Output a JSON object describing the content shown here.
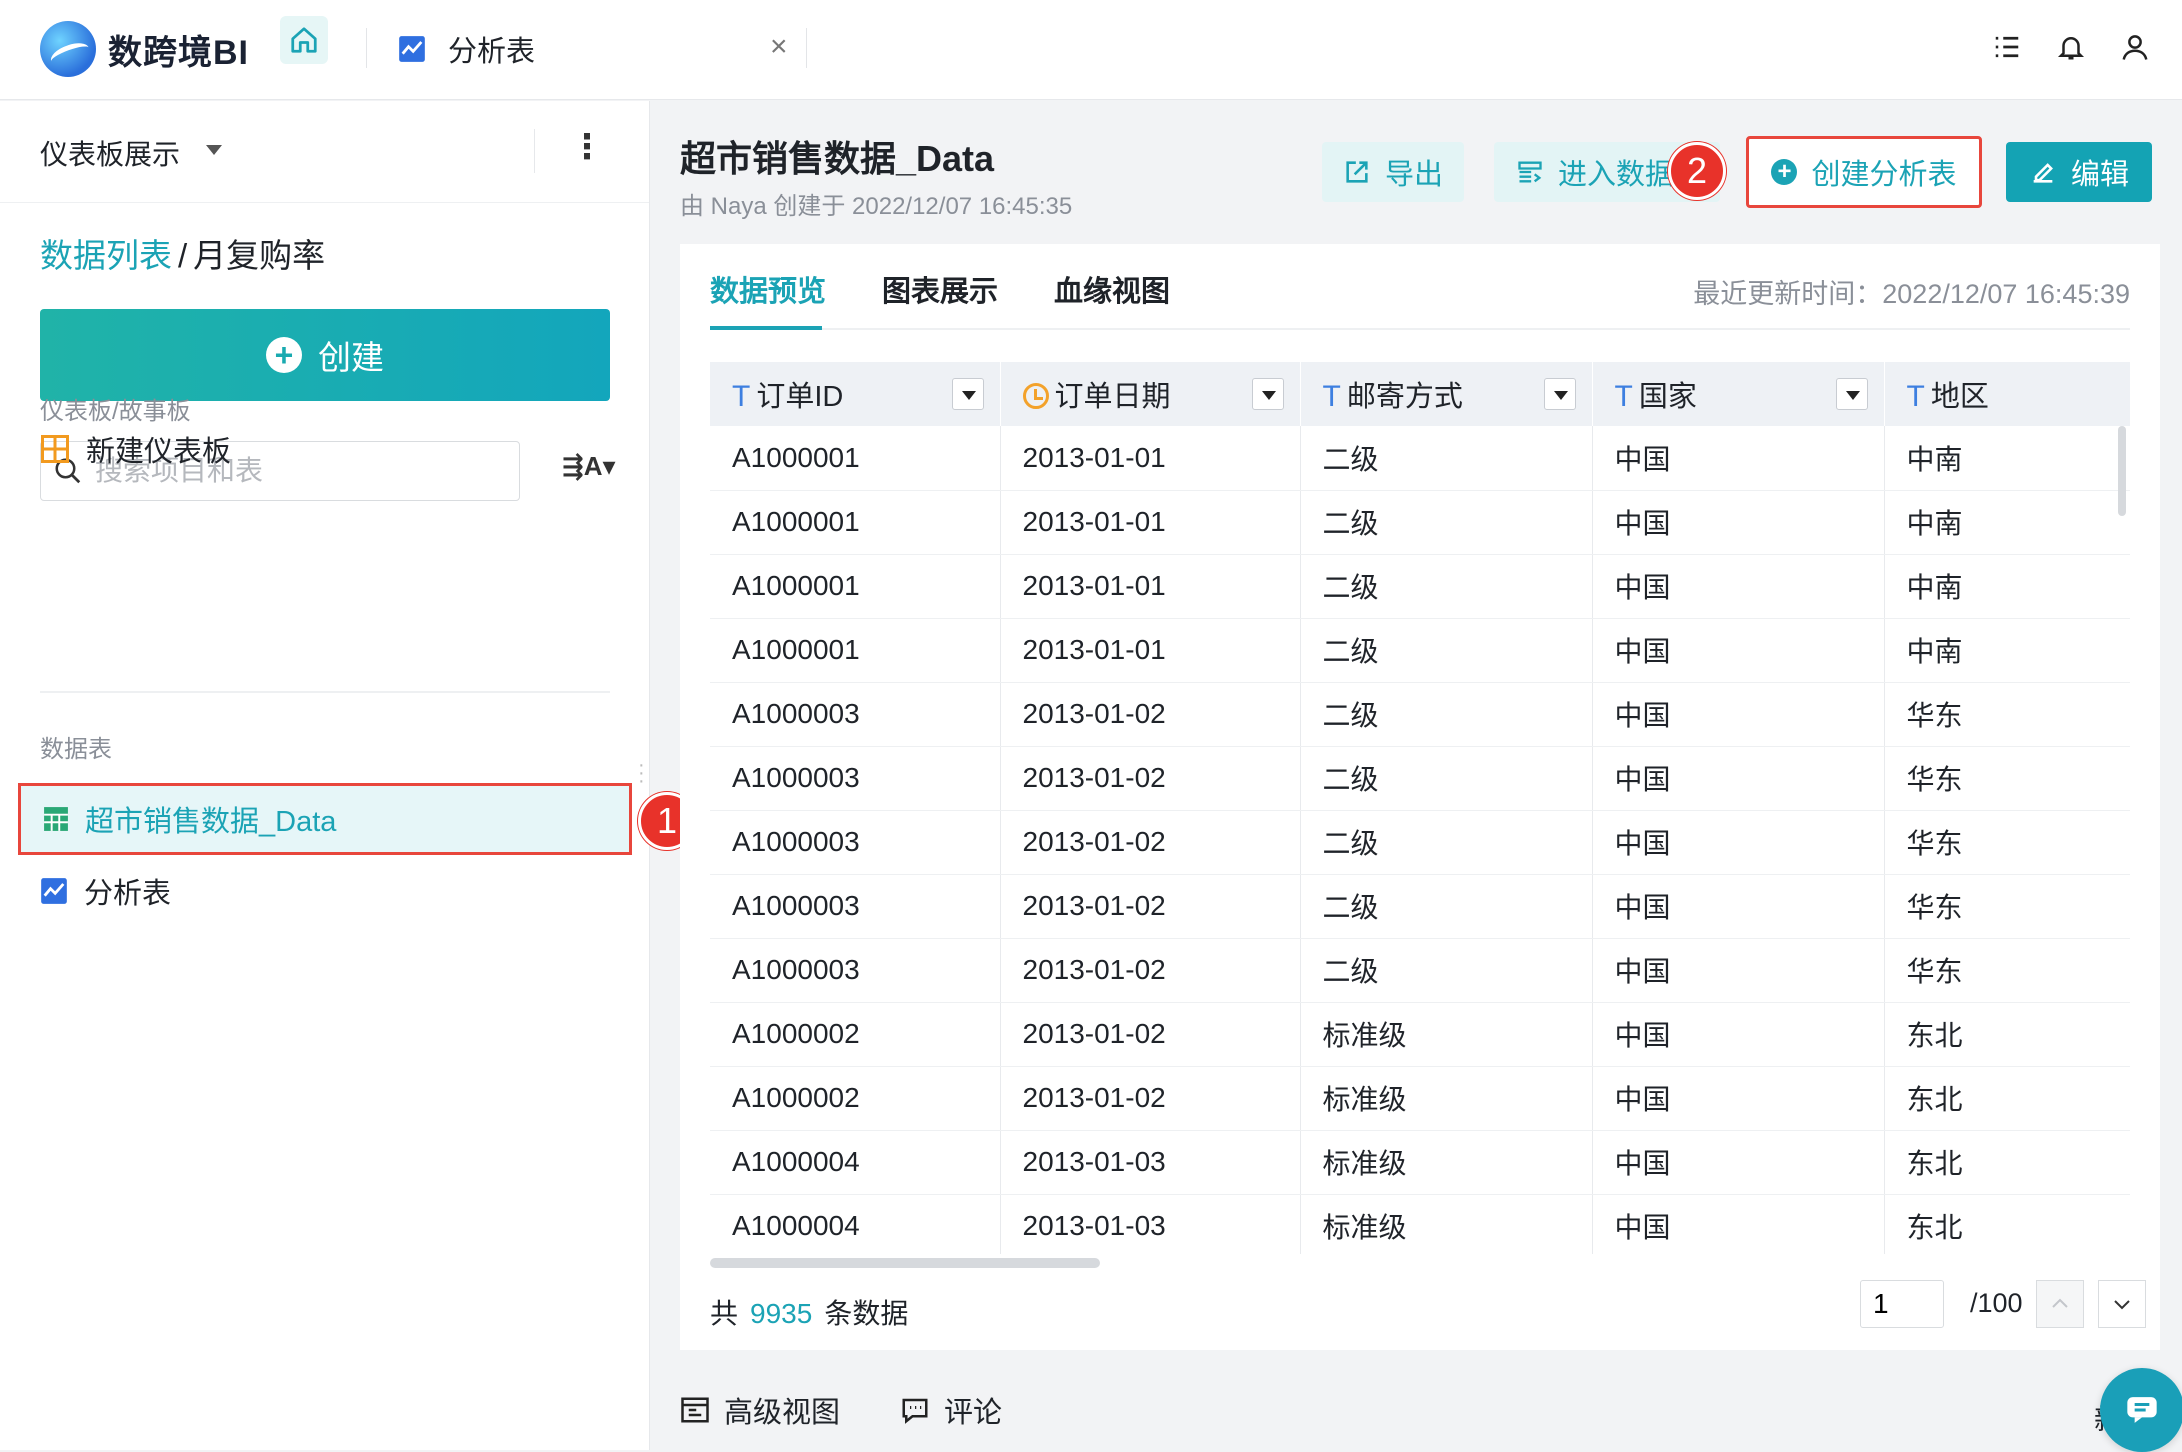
{
  "app": {
    "name": "数跨境BI"
  },
  "top_tab": {
    "label": "分析表"
  },
  "sidebar": {
    "header_title": "仪表板展示",
    "breadcrumb": {
      "link": "数据列表",
      "sep": "/",
      "current": "月复购率"
    },
    "create_label": "创建",
    "search_placeholder": "搜索项目和表",
    "section_dashboards": "仪表板/故事板",
    "new_dashboard": "新建仪表板",
    "section_tables": "数据表",
    "selected_table": "超市销售数据_Data",
    "analysis_table": "分析表"
  },
  "main": {
    "title": "超市销售数据_Data",
    "subtitle": "由 Naya 创建于 2022/12/07 16:45:35",
    "buttons": {
      "export": "导出",
      "enter_data": "进入数据",
      "create_analysis": "创建分析表",
      "edit": "编辑"
    },
    "tabs": [
      "数据预览",
      "图表展示",
      "血缘视图"
    ],
    "last_updated": "最近更新时间：2022/12/07 16:45:39"
  },
  "badges": {
    "first": "1",
    "second": "2"
  },
  "table": {
    "columns": [
      {
        "label": "订单ID",
        "type_mark": "T"
      },
      {
        "label": "订单日期",
        "type_mark": ""
      },
      {
        "label": "邮寄方式",
        "type_mark": "T"
      },
      {
        "label": "国家",
        "type_mark": "T"
      },
      {
        "label": "地区",
        "type_mark": "T"
      }
    ],
    "rows": [
      [
        "A1000001",
        "2013-01-01",
        "二级",
        "中国",
        "中南"
      ],
      [
        "A1000001",
        "2013-01-01",
        "二级",
        "中国",
        "中南"
      ],
      [
        "A1000001",
        "2013-01-01",
        "二级",
        "中国",
        "中南"
      ],
      [
        "A1000001",
        "2013-01-01",
        "二级",
        "中国",
        "中南"
      ],
      [
        "A1000003",
        "2013-01-02",
        "二级",
        "中国",
        "华东"
      ],
      [
        "A1000003",
        "2013-01-02",
        "二级",
        "中国",
        "华东"
      ],
      [
        "A1000003",
        "2013-01-02",
        "二级",
        "中国",
        "华东"
      ],
      [
        "A1000003",
        "2013-01-02",
        "二级",
        "中国",
        "华东"
      ],
      [
        "A1000003",
        "2013-01-02",
        "二级",
        "中国",
        "华东"
      ],
      [
        "A1000002",
        "2013-01-02",
        "标准级",
        "中国",
        "东北"
      ],
      [
        "A1000002",
        "2013-01-02",
        "标准级",
        "中国",
        "东北"
      ],
      [
        "A1000004",
        "2013-01-03",
        "标准级",
        "中国",
        "东北"
      ],
      [
        "A1000004",
        "2013-01-03",
        "标准级",
        "中国",
        "东北"
      ]
    ]
  },
  "footer": {
    "prefix": "共",
    "count": "9935",
    "suffix": "条数据",
    "page_value": "1",
    "page_total": "/100"
  },
  "bottom": {
    "advanced_view": "高级视图",
    "comments": "评论",
    "peek_text": "新"
  },
  "colors": {
    "accent": "#1ba3b5",
    "highlight_border": "#e8463c",
    "badge": "#e8322a"
  }
}
